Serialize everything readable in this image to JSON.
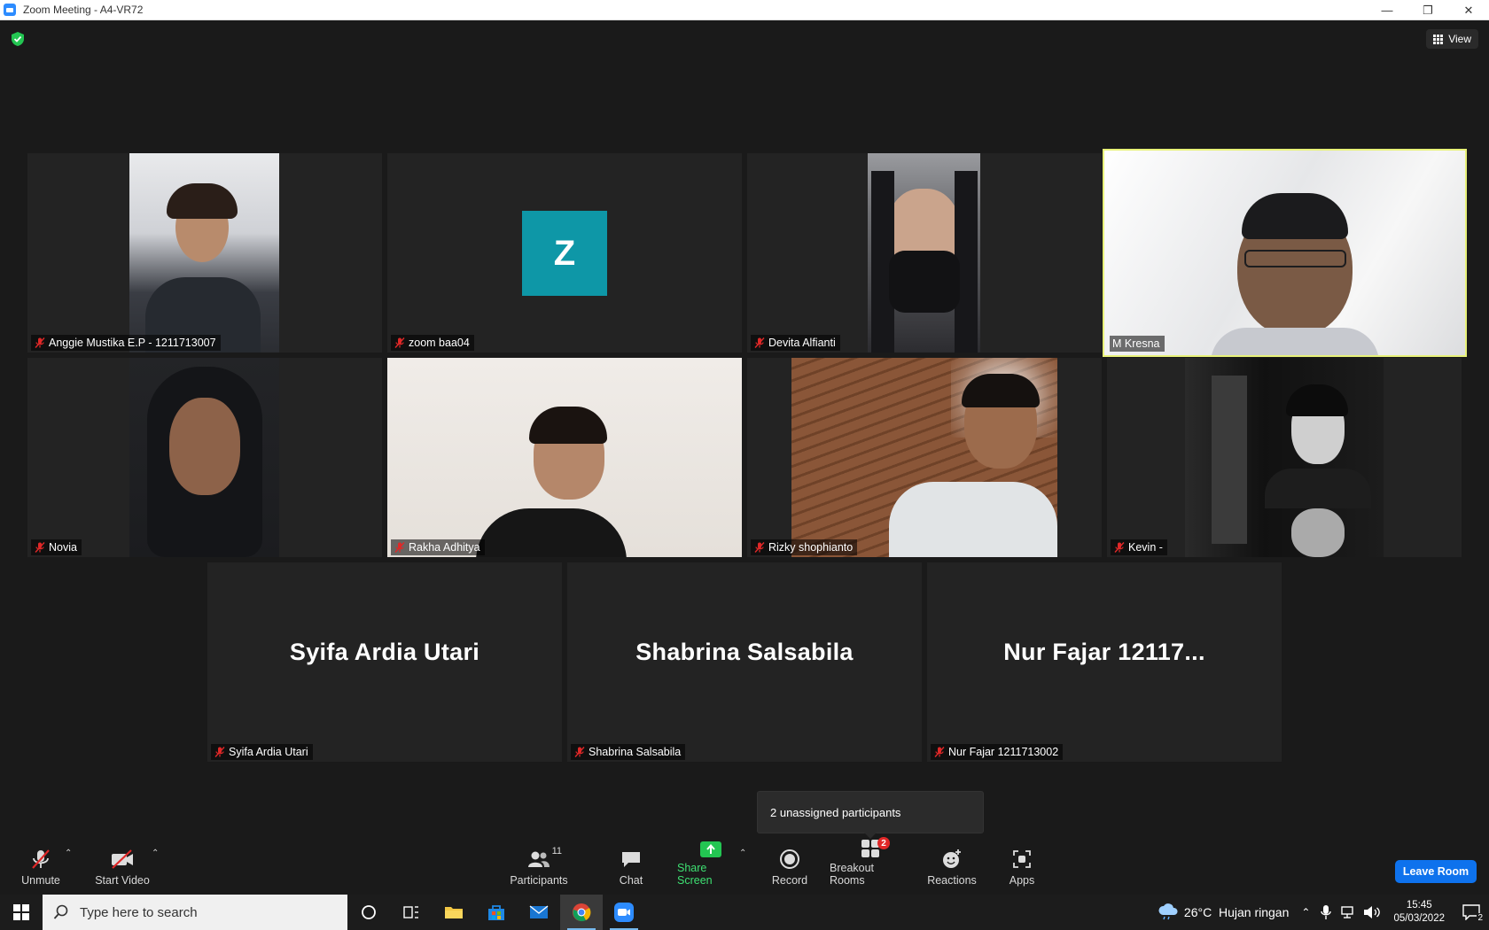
{
  "window": {
    "title": "Zoom Meeting - A4-VR72"
  },
  "header": {
    "view_label": "View"
  },
  "tiles": [
    {
      "name": "Anggie Mustika E.P - 1211713007"
    },
    {
      "name": "zoom baa04",
      "avatar_letter": "Z"
    },
    {
      "name": "Devita Alfianti"
    },
    {
      "name": "M Kresna"
    },
    {
      "name": "Novia"
    },
    {
      "name": "Rakha Adhitya"
    },
    {
      "name": "Rizky shophianto"
    },
    {
      "name": "Kevin -"
    },
    {
      "name": "Syifa Ardia Utari",
      "display_name": "Syifa Ardia Utari"
    },
    {
      "name": "Shabrina Salsabila",
      "display_name": "Shabrina Salsabila"
    },
    {
      "name": "Nur Fajar 1211713002",
      "display_name": "Nur Fajar 12117..."
    }
  ],
  "tooltip": {
    "text": "2 unassigned participants"
  },
  "toolbar": {
    "unmute_label": "Unmute",
    "start_video_label": "Start Video",
    "participants_label": "Participants",
    "participants_count": "11",
    "chat_label": "Chat",
    "share_label": "Share Screen",
    "record_label": "Record",
    "breakout_label": "Breakout Rooms",
    "breakout_badge": "2",
    "reactions_label": "Reactions",
    "apps_label": "Apps",
    "leave_label": "Leave Room"
  },
  "taskbar": {
    "search_placeholder": "Type here to search",
    "weather": "26°C  Hujan ringan",
    "time": "15:45",
    "date": "05/03/2022",
    "notification_count": "2"
  },
  "colors": {
    "accent": "#0e72ed",
    "active_speaker": "#e8f27a",
    "share": "#3ee072",
    "avatar": "#0e97a7",
    "badge": "#e02828"
  }
}
